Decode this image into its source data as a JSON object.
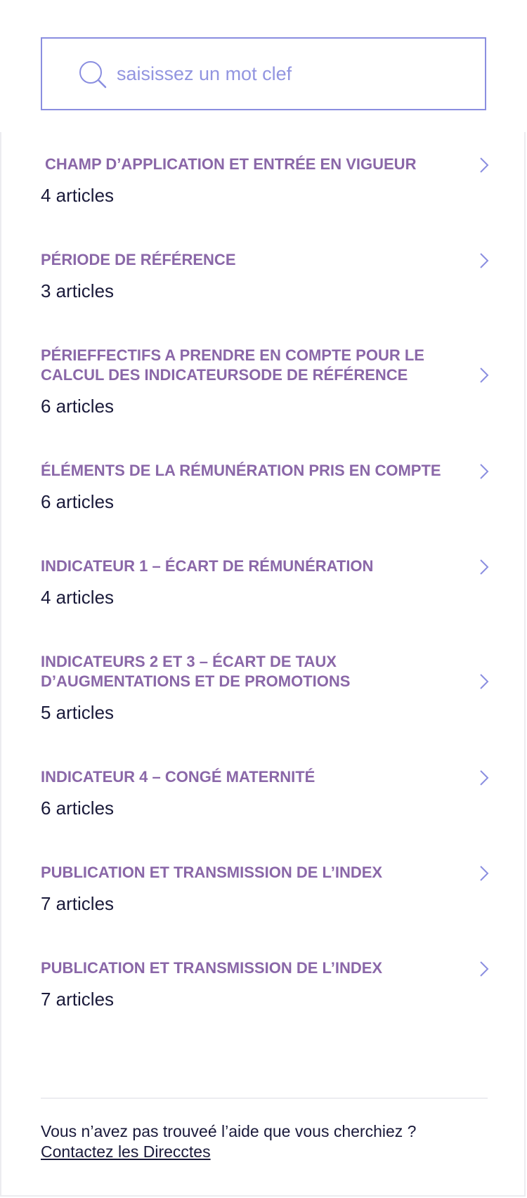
{
  "search": {
    "placeholder": "saisissez un mot clef",
    "icon": "search-icon"
  },
  "categories": [
    {
      "title": "CHAMP D’APPLICATION ET ENTRÉE EN VIGUEUR",
      "count": "4 articles"
    },
    {
      "title": "PÉRIODE DE RÉFÉRENCE",
      "count": "3 articles"
    },
    {
      "title": "PÉRIEFFECTIFS A PRENDRE EN COMPTE POUR LE CALCUL DES INDICATEURSODE DE RÉFÉRENCE",
      "count": "6 articles"
    },
    {
      "title": "ÉLÉMENTS DE LA RÉMUNÉRATION PRIS EN COMPTE",
      "count": "6 articles"
    },
    {
      "title": "INDICATEUR 1 – ÉCART DE RÉMUNÉRATION",
      "count": "4 articles"
    },
    {
      "title": "INDICATEURS 2 ET 3 – ÉCART DE TAUX D’AUGMENTATIONS ET DE PROMOTIONS",
      "count": "5 articles"
    },
    {
      "title": "INDICATEUR 4 – CONGÉ MATERNITÉ",
      "count": "6 articles"
    },
    {
      "title": "PUBLICATION ET TRANSMISSION DE L’INDEX",
      "count": "7 articles"
    },
    {
      "title": "PUBLICATION ET TRANSMISSION DE L’INDEX",
      "count": "7 articles"
    }
  ],
  "footer": {
    "question": "Vous n’avez pas trouveé l’aide que vous cherchiez ?",
    "link_label": "Contactez les Direcctes"
  },
  "colors": {
    "accent": "#8a8ee0",
    "title": "#8a67a8",
    "text": "#1a1a3a"
  }
}
